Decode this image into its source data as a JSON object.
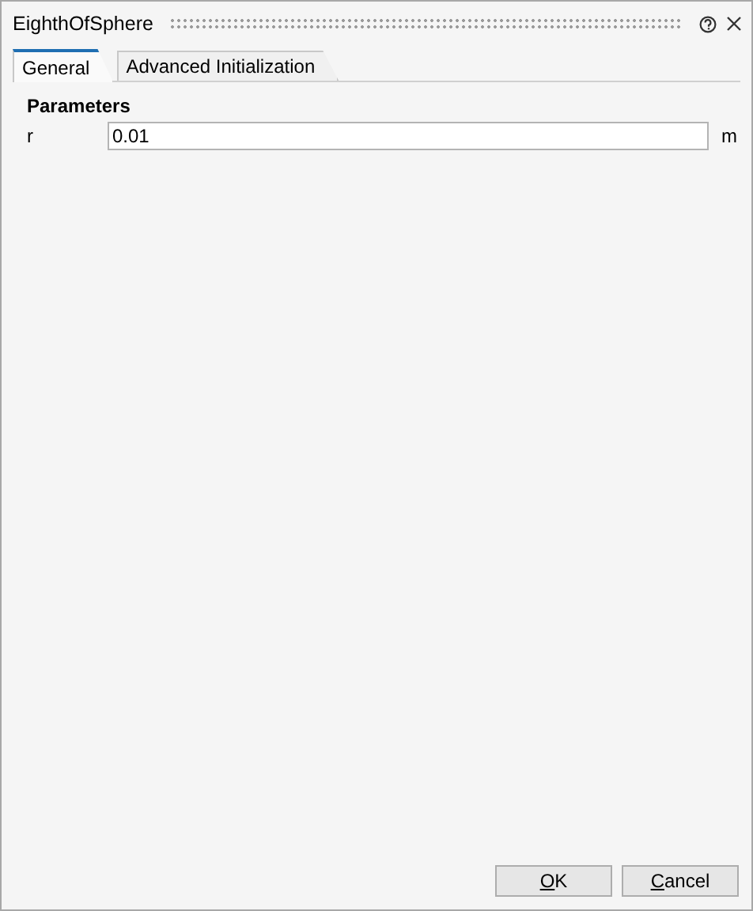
{
  "window": {
    "title": "EighthOfSphere"
  },
  "tabs": [
    {
      "label": "General",
      "selected": true
    },
    {
      "label": "Advanced Initialization",
      "selected": false
    }
  ],
  "section": {
    "title": "Parameters"
  },
  "fields": [
    {
      "label": "r",
      "value": "0.01",
      "unit": "m"
    }
  ],
  "buttons": [
    "OK",
    "Cancel"
  ]
}
